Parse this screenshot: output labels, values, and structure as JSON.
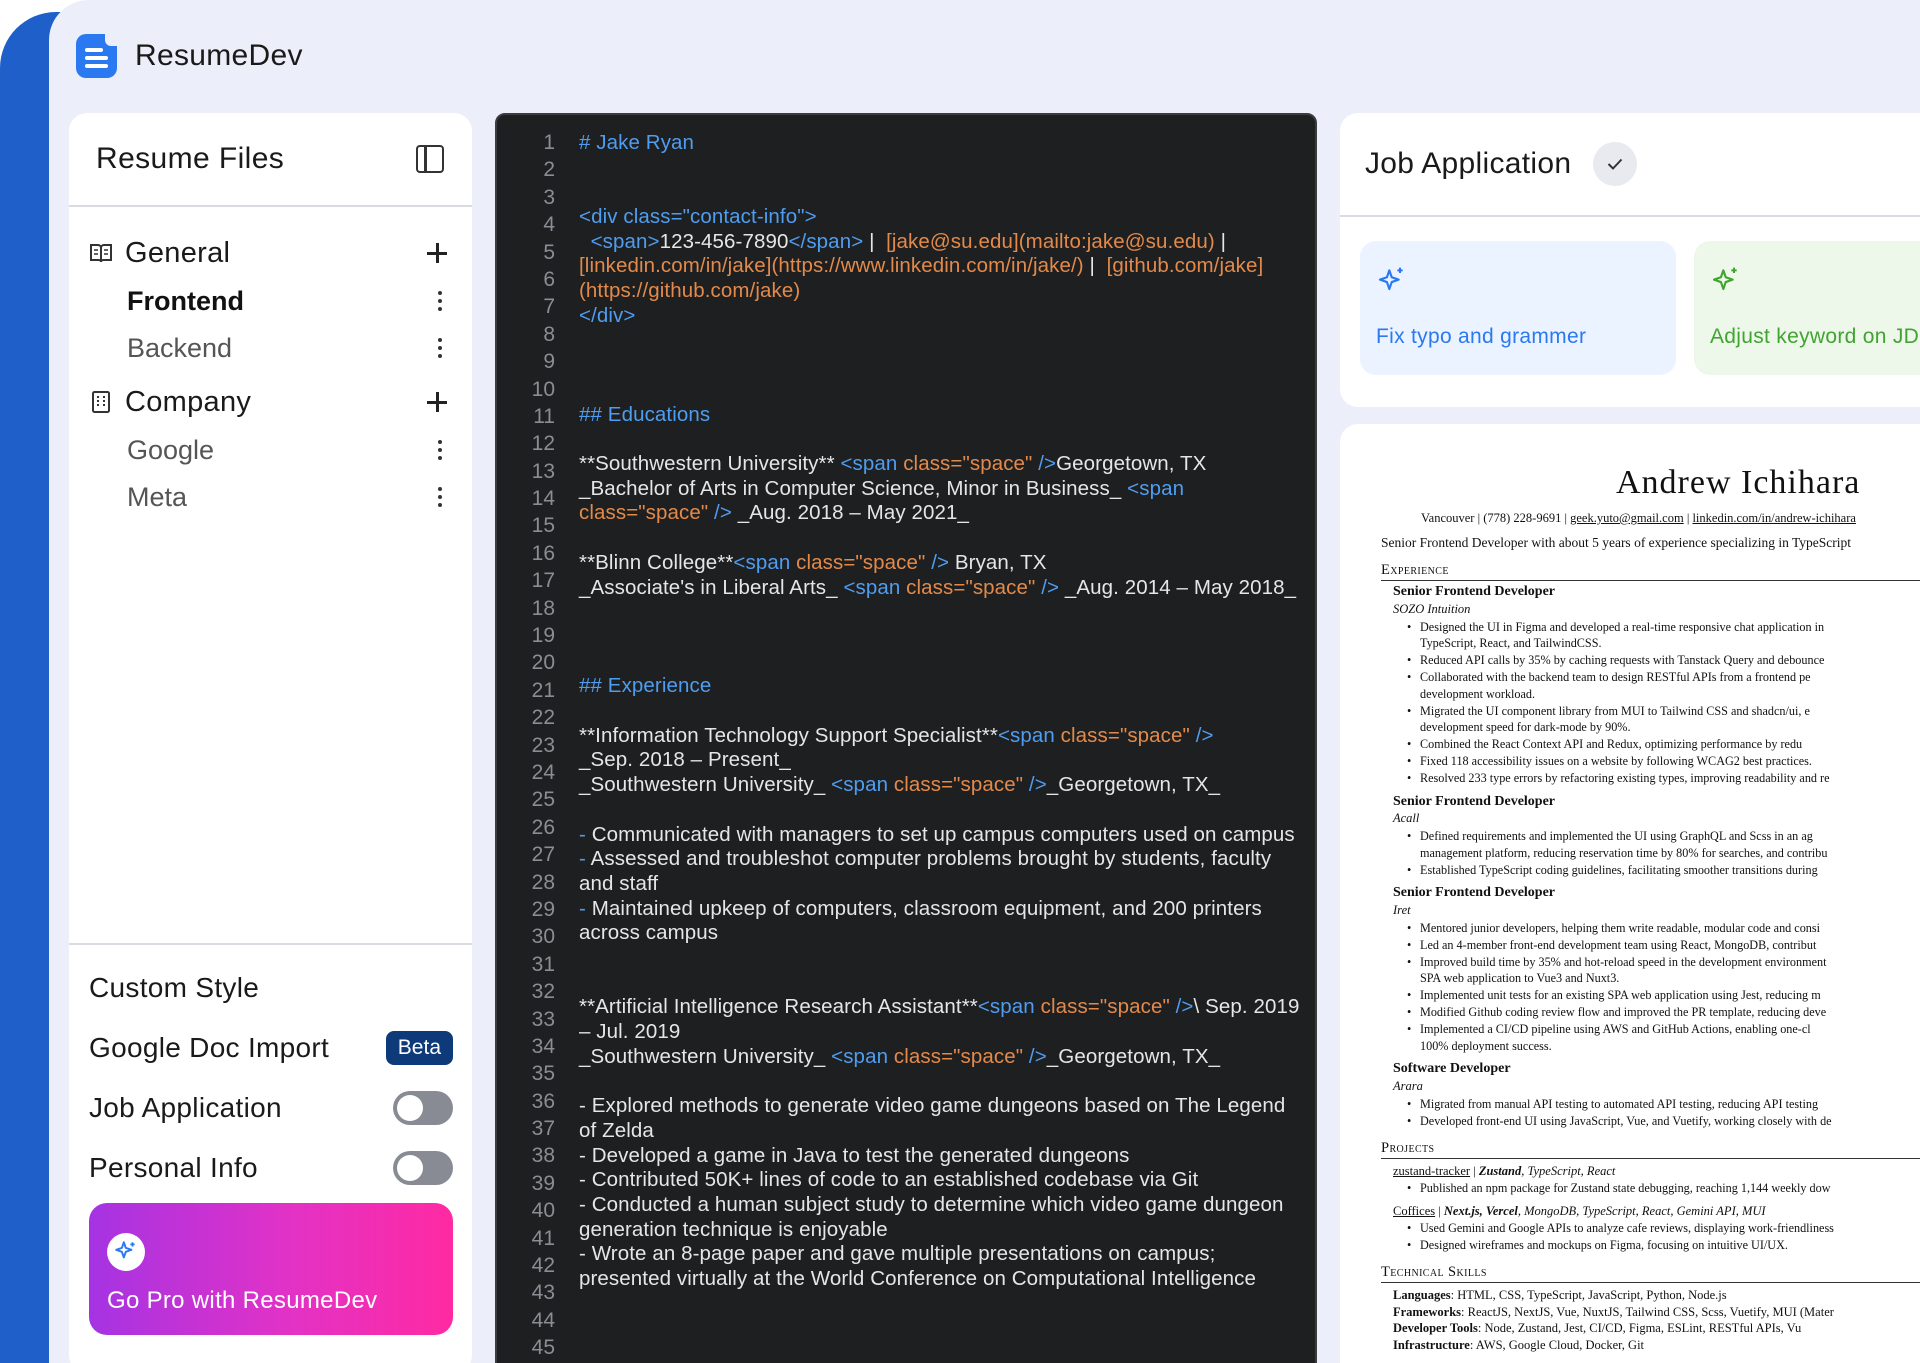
{
  "app": {
    "title": "ResumeDev"
  },
  "sidebar": {
    "title": "Resume Files",
    "groups": [
      {
        "label": "General",
        "files": [
          "Frontend",
          "Backend"
        ]
      },
      {
        "label": "Company",
        "files": [
          "Google",
          "Meta"
        ]
      }
    ],
    "options": {
      "custom_style": "Custom Style",
      "google_doc_import": "Google Doc Import",
      "beta_badge": "Beta",
      "job_application": "Job Application",
      "personal_info": "Personal Info"
    },
    "pro_label": "Go Pro with ResumeDev"
  },
  "editor": {
    "line_numbers": [
      "1",
      "2",
      "3",
      "4",
      "5",
      "6",
      "7",
      "8",
      "9",
      "10",
      "11",
      "12",
      "13",
      "14",
      "15",
      "16",
      "17",
      "18",
      "19",
      "20",
      "21",
      "22",
      "23",
      "24",
      "25",
      "26",
      "27",
      "28",
      "29",
      "30",
      "31",
      "32",
      "33",
      "34",
      "35",
      "36",
      "37",
      "38",
      "39",
      "40",
      "41",
      "42",
      "43",
      "44",
      "45"
    ],
    "l1": "# Jake Ryan",
    "l4": "<div class=\"contact-info\">",
    "l5a": "<span>",
    "l5b": "123-456-7890",
    "l5c": "</span>",
    "l5d": "|",
    "l5e": "[jake@su.edu](mailto:jake@su.edu)",
    "l5f": "|",
    "l5g": "[linkedin.com/in/jake](https://www.linkedin.com/in/jake/)",
    "l5h": "|",
    "l5i": "[github.com/jake](https://github.com/jake)",
    "l8": "</div>",
    "educations": "## Educations",
    "edu1a": "**Southwestern University**",
    "span_open": "<span",
    "span_attr": "class=\"space\"",
    "span_close": "/>",
    "edu1b": "Georgetown, TX",
    "edu1c": "_Bachelor of Arts in Computer Science, Minor in Business_",
    "edu1d": "_Aug. 2018 – May 2021_",
    "edu2a": "**Blinn College**",
    "edu2b": "Bryan, TX",
    "edu2c": "_Associate's in Liberal Arts_",
    "edu2d": "_Aug. 2014 – May 2018_",
    "experience": "## Experience",
    "exp1a": "**Information Technology Support Specialist**",
    "exp1b": "_Sep. 2018 – Present_",
    "exp1c": "_Southwestern University_",
    "exp1d": "_Georgetown, TX_",
    "dash": "-",
    "exp1e": "Communicated with managers to set up campus computers used on campus",
    "exp1f": "Assessed and troubleshot computer problems brought by students, faculty and staff",
    "exp1g": "Maintained upkeep of computers, classroom equipment, and 200 printers across campus",
    "exp2a": "**Artificial Intelligence Research Assistant**",
    "exp2b": "\\ Sep. 2019 – Jul. 2019",
    "exp2c": "_Southwestern University_",
    "exp2d": "_Georgetown, TX_",
    "exp2e": "- Explored methods to generate video game dungeons based on The Legend of Zelda",
    "exp2f": "- Developed a game in Java to test the generated dungeons",
    "exp2g": "- Contributed 50K+ lines of code to an established codebase via Git",
    "exp2h": "- Conducted a human subject study to determine which video game dungeon generation technique is enjoyable",
    "exp2i": "- Wrote an 8-page paper and gave multiple presentations on campus; presented virtually at the World Conference on Computational Intelligence"
  },
  "job_application": {
    "title": "Job Application",
    "cards": [
      {
        "label": "Fix typo and grammer",
        "color": "#2a79f0"
      },
      {
        "label": "Adjust keyword on JD",
        "color": "#41a431"
      }
    ]
  },
  "preview": {
    "name": "Andrew Ichihara",
    "contact_city": "Vancouver",
    "contact_phone": "(778) 228-9691",
    "contact_email": "geek.yuto@gmail.com",
    "contact_linkedin": "linkedin.com/in/andrew-ichihara",
    "summary": "Senior Frontend Developer with about 5 years of experience specializing in TypeScript",
    "sections": {
      "experience": "Experience",
      "projects": "Projects",
      "skills": "Technical Skills"
    },
    "jobs": [
      {
        "title": "Senior Frontend Developer",
        "company": "SOZO Intuition",
        "lines": [
          "Designed the UI in Figma and developed a real-time responsive chat application in",
          "TypeScript, React, and TailwindCSS.",
          "Reduced API calls by 35% by caching requests with Tanstack Query and debounce",
          "Collaborated with the backend team to design RESTful APIs from a frontend pe",
          "development workload.",
          "Migrated the UI component library from MUI to Tailwind CSS and shadcn/ui, e",
          "development speed for dark-mode by 90%.",
          "Combined the React Context API and Redux, optimizing performance by redu",
          "Fixed 118 accessibility issues on a website by following WCAG2 best practices.",
          "Resolved 233 type errors by refactoring existing types, improving readability and re"
        ]
      },
      {
        "title": "Senior Frontend Developer",
        "company": "Acall",
        "lines": [
          "Defined requirements and implemented the UI using GraphQL and Scss in an ag",
          "management platform, reducing reservation time by 80% for searches, and contribu",
          "Established TypeScript coding guidelines, facilitating smoother transitions during"
        ]
      },
      {
        "title": "Senior Frontend Developer",
        "company": "Iret",
        "lines": [
          "Mentored junior developers, helping them write readable, modular code and consi",
          "Led an 4-member front-end development team using React, MongoDB, contribut",
          "Improved build time by 35% and hot-reload speed in the development environment",
          "SPA web application to Vue3 and Nuxt3.",
          "Implemented unit tests for an existing SPA web application using Jest, reducing m",
          "Modified Github coding review flow and improved the PR template, reducing deve",
          "Implemented a CI/CD pipeline using AWS and GitHub Actions, enabling one-cl",
          "100% deployment success."
        ]
      },
      {
        "title": "Software Developer",
        "company": "Arara",
        "lines": [
          "Migrated from manual API testing to automated API testing, reducing API testing",
          "Developed front-end UI using JavaScript, Vue, and Vuetify, working closely with de"
        ]
      }
    ],
    "projects": [
      {
        "name": "zustand-tracker",
        "stack_bold": "Zustand",
        "stack": ", TypeScript, React",
        "lines": [
          "Published an npm package for Zustand state debugging, reaching 1,144 weekly dow"
        ]
      },
      {
        "name": "Coffices",
        "stack_bold": "Next.js, Vercel",
        "stack": ", MongoDB, TypeScript, React, Gemini API, MUI",
        "lines": [
          "Used Gemini and Google APIs to analyze cafe reviews, displaying work-friendliness",
          "Designed wireframes and mockups on Figma, focusing on intuitive UI/UX."
        ]
      }
    ],
    "skills": [
      {
        "label": "Languages",
        "value": ": HTML, CSS, TypeScript, JavaScript, Python, Node.js"
      },
      {
        "label": "Frameworks",
        "value": ": ReactJS, NextJS, Vue, NuxtJS, Tailwind CSS, Scss, Vuetify, MUI (Mater"
      },
      {
        "label": "Developer Tools",
        "value": ": Node, Zustand, Jest, CI/CD, Figma, ESLint, RESTful APIs, Vu"
      },
      {
        "label": "Infrastructure",
        "value": ": AWS, Google Cloud, Docker, Git"
      }
    ]
  }
}
